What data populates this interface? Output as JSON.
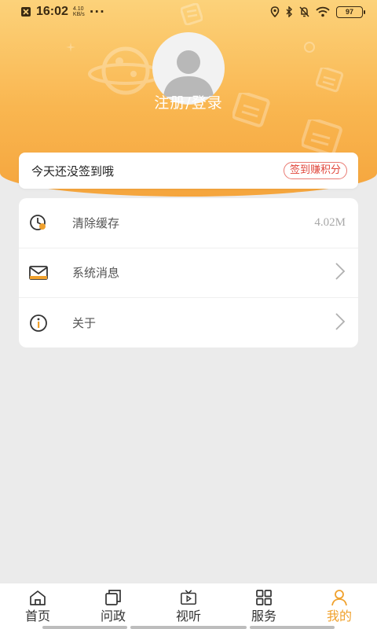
{
  "status_bar": {
    "time": "16:02",
    "net_speed_value": "4.10",
    "net_speed_unit": "KB/s",
    "more": "···",
    "battery": "97"
  },
  "profile": {
    "login_label": "注册/登录"
  },
  "signin": {
    "message": "今天还没签到哦",
    "button_label": "签到赚积分"
  },
  "menu": {
    "items": [
      {
        "label": "清除缓存",
        "value": "4.02M",
        "icon": "clear-cache-icon"
      },
      {
        "label": "系统消息",
        "icon": "mail-icon"
      },
      {
        "label": "关于",
        "icon": "info-icon"
      }
    ]
  },
  "tabbar": {
    "items": [
      {
        "label": "首页",
        "icon": "home-icon"
      },
      {
        "label": "问政",
        "icon": "copy-icon"
      },
      {
        "label": "视听",
        "icon": "tv-icon"
      },
      {
        "label": "服务",
        "icon": "grid-icon"
      },
      {
        "label": "我的",
        "icon": "user-icon",
        "active": true
      }
    ]
  },
  "colors": {
    "accent": "#f0a12d",
    "header_top": "#fcd27a",
    "header_bottom": "#f5a53d",
    "signin_button": "#e0453a"
  }
}
